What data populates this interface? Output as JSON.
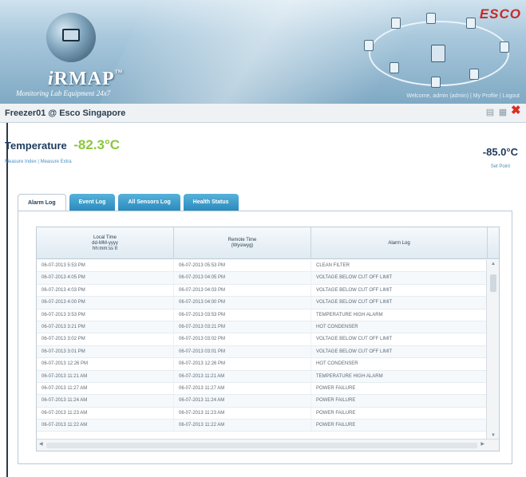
{
  "banner": {
    "app_name": "RMAP",
    "app_name_prefix": "i",
    "trademark": "™",
    "tagline": "Monitoring Lab Equipment 24x7",
    "brand": "ESCO",
    "welcome_text": "Welcome, admin (admin) | My Profile | Logout"
  },
  "titlebar": {
    "title": "Freezer01 @ Esco Singapore",
    "icons": [
      "printer-icon",
      "calendar-icon",
      "close-icon"
    ]
  },
  "reading": {
    "label": "Temperature",
    "value": "-82.3°C",
    "links": "Measure Index | Measure Extra"
  },
  "setpoint": {
    "value": "-85.0°C",
    "label": "Set Point"
  },
  "tabs": [
    {
      "label": "Alarm Log",
      "active": true
    },
    {
      "label": "Event Log",
      "active": false
    },
    {
      "label": "All Sensors Log",
      "active": false
    },
    {
      "label": "Health Status",
      "active": false
    }
  ],
  "grid": {
    "headers": {
      "local_time": [
        "Local Time",
        "dd-MM-yyyy",
        "hh:mm:ss tt"
      ],
      "remote_time": [
        "Remote Time",
        "(Wysiwyg)"
      ],
      "alarm_log": "Alarm Log"
    },
    "rows": [
      [
        "06-07-2013 5:53 PM",
        "06-07-2013 05:53 PM",
        "CLEAN FILTER"
      ],
      [
        "06-07-2013 4:05 PM",
        "06-07-2013 04:05 PM",
        "VOLTAGE BELOW CUT OFF LIMIT"
      ],
      [
        "06-07-2013 4:03 PM",
        "06-07-2013 04:03 PM",
        "VOLTAGE BELOW CUT OFF LIMIT"
      ],
      [
        "06-07-2013 4:00 PM",
        "06-07-2013 04:00 PM",
        "VOLTAGE BELOW CUT OFF LIMIT"
      ],
      [
        "06-07-2013 3:53 PM",
        "06-07-2013 03:53 PM",
        "TEMPERATURE HIGH ALARM"
      ],
      [
        "06-07-2013 3:21 PM",
        "06-07-2013 03:21 PM",
        "HOT CONDENSER"
      ],
      [
        "06-07-2013 3:02 PM",
        "06-07-2013 03:02 PM",
        "VOLTAGE BELOW CUT OFF LIMIT"
      ],
      [
        "06-07-2013 3:01 PM",
        "06-07-2013 03:01 PM",
        "VOLTAGE BELOW CUT OFF LIMIT"
      ],
      [
        "06-07-2013 12:26 PM",
        "06-07-2013 12:26 PM",
        "HOT CONDENSER"
      ],
      [
        "06-07-2013 11:21 AM",
        "06-07-2013 11:21 AM",
        "TEMPERATURE HIGH ALARM"
      ],
      [
        "06-07-2013 11:27 AM",
        "06-07-2013 11:27 AM",
        "POWER FAILURE"
      ],
      [
        "06-07-2013 11:24 AM",
        "06-07-2013 11:24 AM",
        "POWER FAILURE"
      ],
      [
        "06-07-2013 11:23 AM",
        "06-07-2013 11:23 AM",
        "POWER FAILURE"
      ],
      [
        "06-07-2013 11:22 AM",
        "06-07-2013 11:22 AM",
        "POWER FAILURE"
      ]
    ]
  },
  "colors": {
    "temperature_value": "#8dc63f",
    "tab_blue": "#2a89bd",
    "close_red": "#d93025",
    "brand_red": "#c62a2a"
  }
}
